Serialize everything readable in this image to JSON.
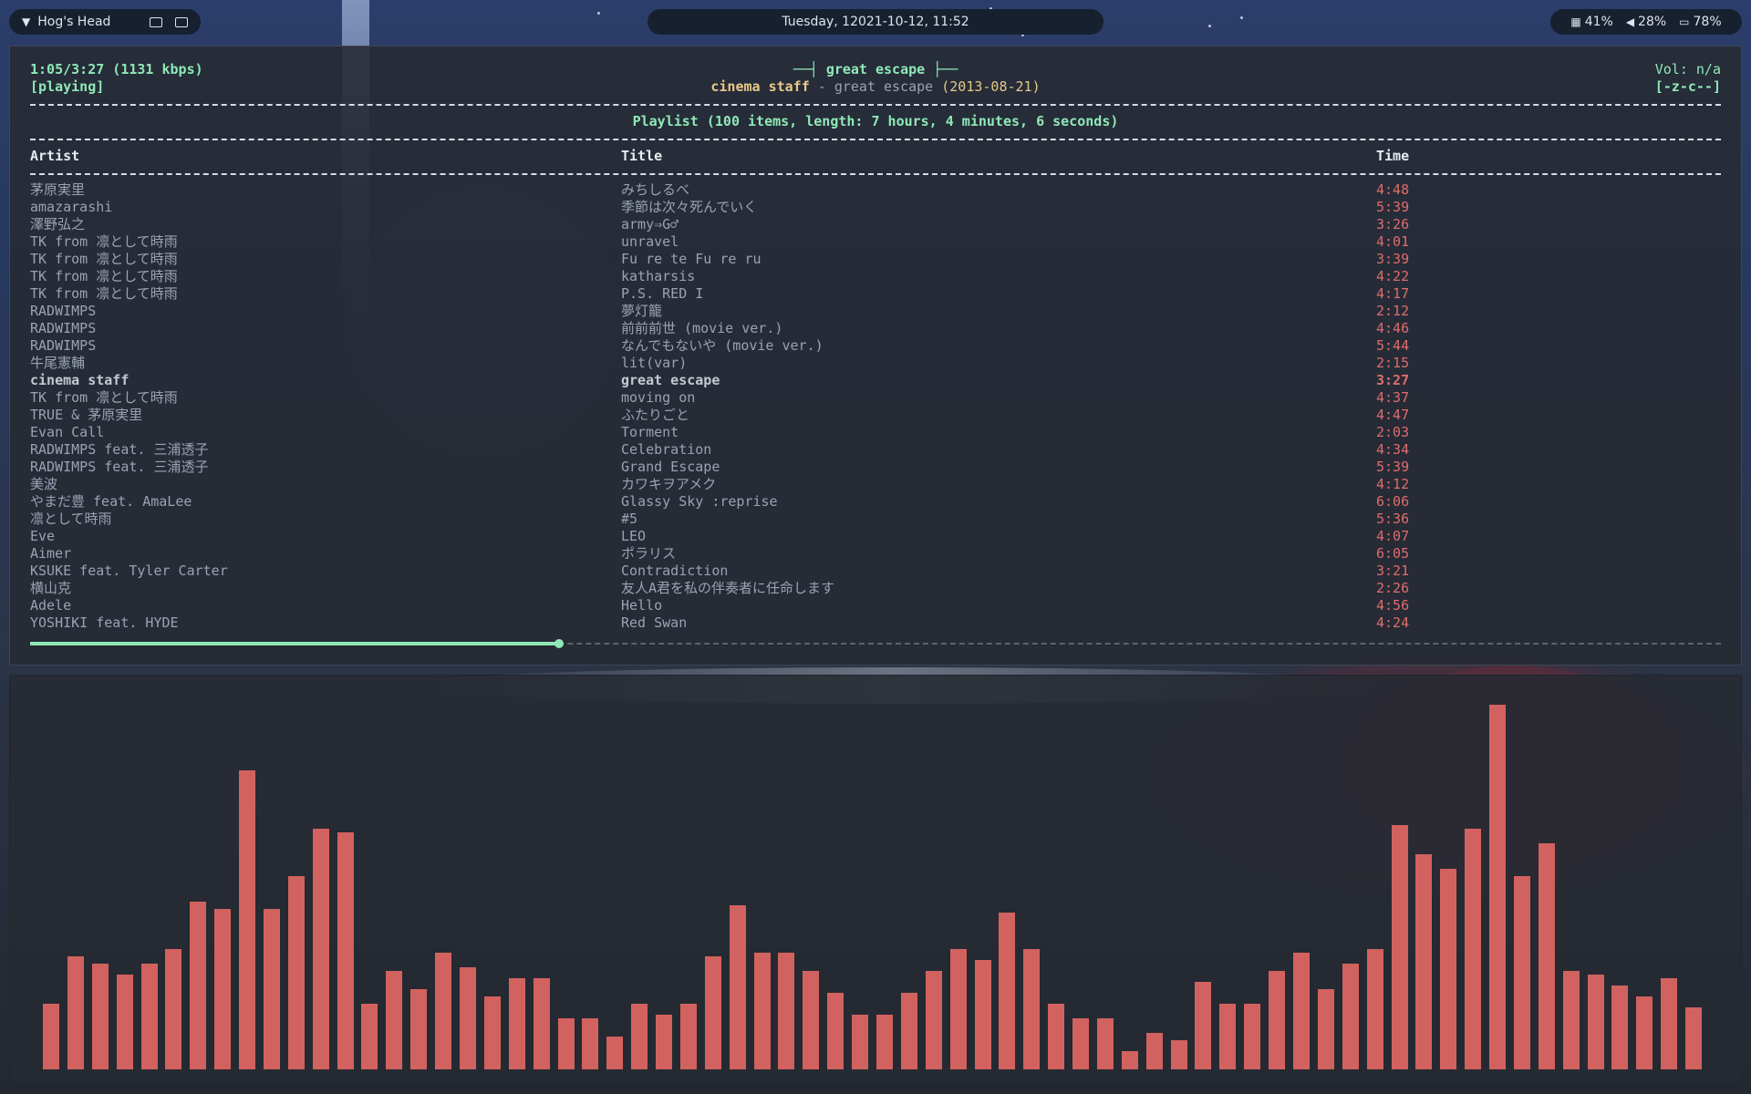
{
  "topbar": {
    "workspace": "Hog's Head",
    "datetime": "Tuesday, 12021-10-12, 11:52",
    "cpu": "41%",
    "volume": "28%",
    "battery": "78%"
  },
  "player": {
    "time_info": "1:05/3:27 (1131 kbps)",
    "status": "[playing]",
    "now_playing_title": "great escape",
    "now_artist": "cinema staff",
    "now_separator": "-",
    "now_song": "great escape",
    "now_date": "(2013-08-21)",
    "volume": "Vol: n/a",
    "flags": "[-z-c--]",
    "playlist_summary": "Playlist (100 items, length: 7 hours, 4 minutes, 6 seconds)",
    "progress_fraction": 0.313
  },
  "columns": {
    "artist": "Artist",
    "title": "Title",
    "time": "Time"
  },
  "playlist": [
    {
      "artist": "茅原実里",
      "title": "みちしるべ",
      "time": "4:48"
    },
    {
      "artist": "amazarashi",
      "title": "季節は次々死んでいく",
      "time": "5:39"
    },
    {
      "artist": "澤野弘之",
      "title": "army⇒G♂",
      "time": "3:26"
    },
    {
      "artist": "TK from 凛として時雨",
      "title": "unravel",
      "time": "4:01"
    },
    {
      "artist": "TK from 凛として時雨",
      "title": "Fu re te Fu re ru",
      "time": "3:39"
    },
    {
      "artist": "TK from 凛として時雨",
      "title": "katharsis",
      "time": "4:22"
    },
    {
      "artist": "TK from 凛として時雨",
      "title": "P.S. RED I",
      "time": "4:17"
    },
    {
      "artist": "RADWIMPS",
      "title": "夢灯籠",
      "time": "2:12"
    },
    {
      "artist": "RADWIMPS",
      "title": "前前前世 (movie ver.)",
      "time": "4:46"
    },
    {
      "artist": "RADWIMPS",
      "title": "なんでもないや (movie ver.)",
      "time": "5:44"
    },
    {
      "artist": "牛尾憲輔",
      "title": "lit(var)",
      "time": "2:15"
    },
    {
      "artist": "cinema staff",
      "title": "great escape",
      "time": "3:27",
      "current": true
    },
    {
      "artist": "TK from 凛として時雨",
      "title": "moving on",
      "time": "4:37"
    },
    {
      "artist": "TRUE & 茅原実里",
      "title": "ふたりごと",
      "time": "4:47"
    },
    {
      "artist": "Evan Call",
      "title": "Torment",
      "time": "2:03"
    },
    {
      "artist": "RADWIMPS feat. 三浦透子",
      "title": "Celebration",
      "time": "4:34"
    },
    {
      "artist": "RADWIMPS feat. 三浦透子",
      "title": "Grand Escape",
      "time": "5:39"
    },
    {
      "artist": "美波",
      "title": "カワキヲアメク",
      "time": "4:12"
    },
    {
      "artist": "やまだ豊 feat. AmaLee",
      "title": "Glassy Sky :reprise",
      "time": "6:06"
    },
    {
      "artist": "凛として時雨",
      "title": "#5",
      "time": "5:36"
    },
    {
      "artist": "Eve",
      "title": "LEO",
      "time": "4:07"
    },
    {
      "artist": "Aimer",
      "title": "ポラリス",
      "time": "6:05"
    },
    {
      "artist": "KSUKE feat. Tyler Carter",
      "title": "Contradiction",
      "time": "3:21"
    },
    {
      "artist": "横山克",
      "title": "友人A君を私の伴奏者に任命します",
      "time": "2:26"
    },
    {
      "artist": "Adele",
      "title": "Hello",
      "time": "4:56"
    },
    {
      "artist": "YOSHIKI feat. HYDE",
      "title": "Red Swan",
      "time": "4:24"
    }
  ],
  "visualizer": {
    "color": "#d2625f",
    "levels": [
      0.18,
      0.31,
      0.29,
      0.26,
      0.29,
      0.33,
      0.46,
      0.44,
      0.82,
      0.44,
      0.53,
      0.66,
      0.65,
      0.18,
      0.27,
      0.22,
      0.32,
      0.28,
      0.2,
      0.25,
      0.25,
      0.14,
      0.14,
      0.09,
      0.18,
      0.15,
      0.18,
      0.31,
      0.45,
      0.32,
      0.32,
      0.27,
      0.21,
      0.15,
      0.15,
      0.21,
      0.27,
      0.33,
      0.3,
      0.43,
      0.33,
      0.18,
      0.14,
      0.14,
      0.05,
      0.1,
      0.08,
      0.24,
      0.18,
      0.18,
      0.27,
      0.32,
      0.22,
      0.29,
      0.33,
      0.67,
      0.59,
      0.55,
      0.66,
      1.0,
      0.53,
      0.62,
      0.27,
      0.26,
      0.23,
      0.2,
      0.25,
      0.17
    ]
  }
}
